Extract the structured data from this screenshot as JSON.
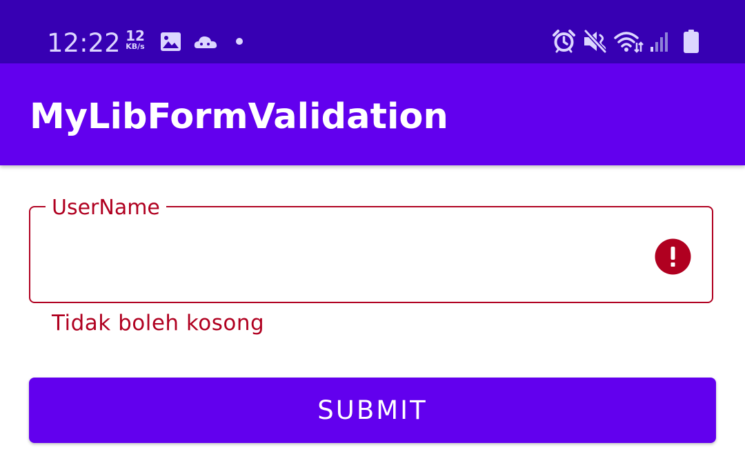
{
  "status_bar": {
    "time": "12:22",
    "net_speed_value": "12",
    "net_speed_unit": "KB/s",
    "left_icons": [
      "gallery-icon",
      "cloud-icon",
      "dot-icon"
    ],
    "right_icons": [
      "alarm-icon",
      "mute-icon",
      "wifi-icon",
      "signal-icon",
      "battery-icon"
    ]
  },
  "app_bar": {
    "title": "MyLibFormValidation"
  },
  "form": {
    "username": {
      "label": "UserName",
      "value": "",
      "error_text": "Tidak boleh kosong",
      "trailing_icon": "error-icon"
    },
    "submit_label": "SUBMIT"
  },
  "colors": {
    "status_bar": "#3700b3",
    "primary": "#6200ee",
    "error": "#b00020",
    "on_primary": "#ffffff"
  }
}
